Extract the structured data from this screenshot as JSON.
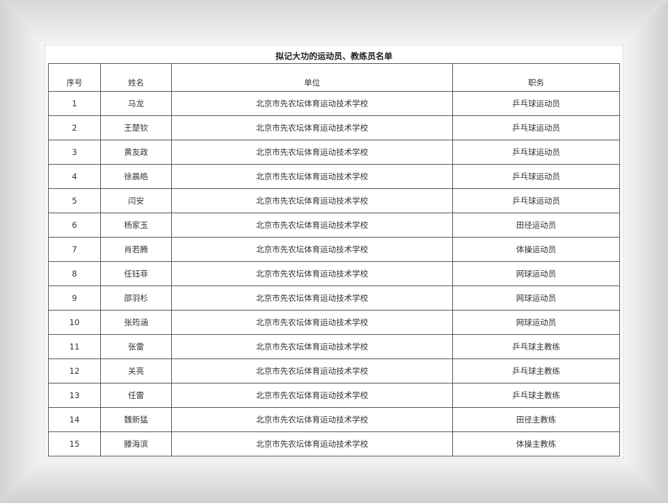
{
  "title": "拟记大功的运动员、教练员名单",
  "table": {
    "headers": [
      "序号",
      "姓名",
      "单位",
      "职务"
    ],
    "rows": [
      [
        "1",
        "马龙",
        "北京市先农坛体育运动技术学校",
        "乒乓球运动员"
      ],
      [
        "2",
        "王楚钦",
        "北京市先农坛体育运动技术学校",
        "乒乓球运动员"
      ],
      [
        "3",
        "黄友政",
        "北京市先农坛体育运动技术学校",
        "乒乓球运动员"
      ],
      [
        "4",
        "徐晨皓",
        "北京市先农坛体育运动技术学校",
        "乒乓球运动员"
      ],
      [
        "5",
        "闫安",
        "北京市先农坛体育运动技术学校",
        "乒乓球运动员"
      ],
      [
        "6",
        "杨家玉",
        "北京市先农坛体育运动技术学校",
        "田径运动员"
      ],
      [
        "7",
        "肖若腾",
        "北京市先农坛体育运动技术学校",
        "体操运动员"
      ],
      [
        "8",
        "任钰菲",
        "北京市先农坛体育运动技术学校",
        "网球运动员"
      ],
      [
        "9",
        "邵羽杉",
        "北京市先农坛体育运动技术学校",
        "网球运动员"
      ],
      [
        "10",
        "张筠涵",
        "北京市先农坛体育运动技术学校",
        "网球运动员"
      ],
      [
        "11",
        "张雷",
        "北京市先农坛体育运动技术学校",
        "乒乓球主教练"
      ],
      [
        "12",
        "关亮",
        "北京市先农坛体育运动技术学校",
        "乒乓球主教练"
      ],
      [
        "13",
        "任雷",
        "北京市先农坛体育运动技术学校",
        "乒乓球主教练"
      ],
      [
        "14",
        "魏新猛",
        "北京市先农坛体育运动技术学校",
        "田径主教练"
      ],
      [
        "15",
        "滕海滨",
        "北京市先农坛体育运动技术学校",
        "体操主教练"
      ]
    ]
  }
}
